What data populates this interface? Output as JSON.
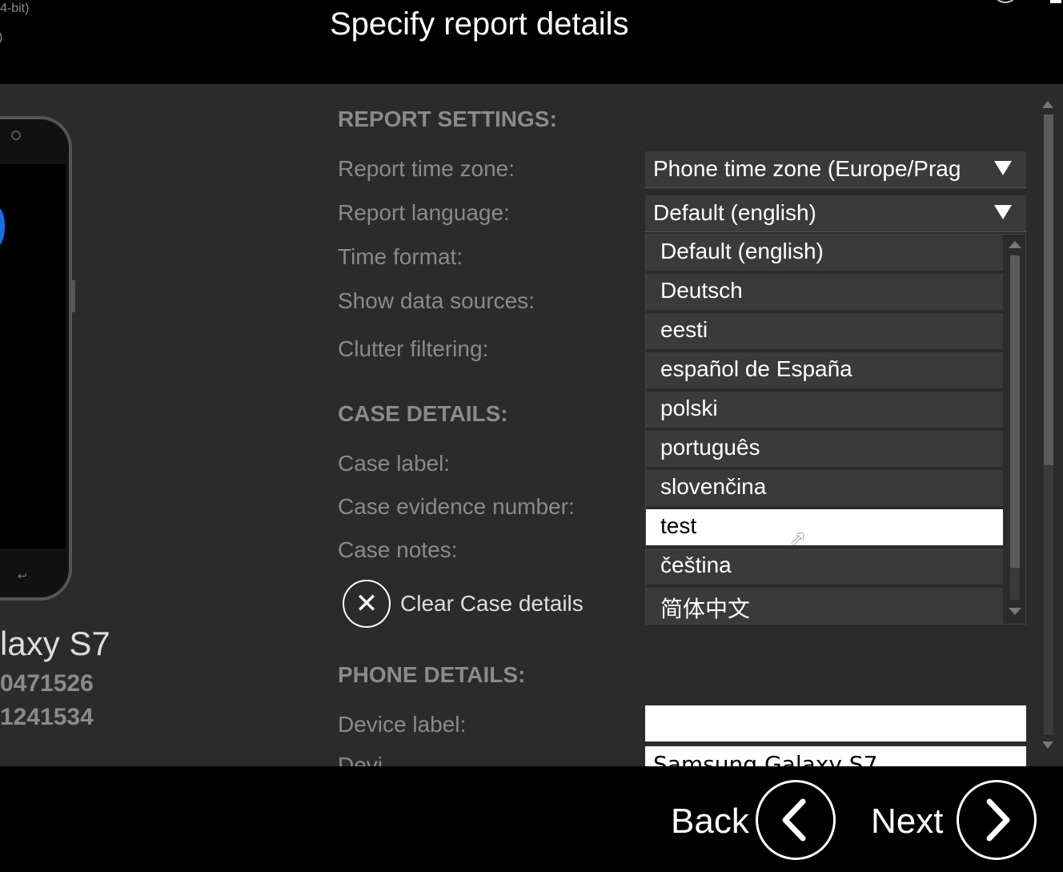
{
  "header": {
    "title": "Specify report details",
    "corner_text_1": "4-bit)",
    "corner_text_2": ")"
  },
  "device": {
    "model": "laxy S7",
    "line1": "0471526",
    "line2": "1241534"
  },
  "report_settings": {
    "heading": "REPORT SETTINGS:",
    "time_zone_label": "Report time zone:",
    "time_zone_value": "Phone time zone (Europe/Prag",
    "language_label": "Report language:",
    "language_value": "Default (english)",
    "time_format_label": "Time format:",
    "show_sources_label": "Show data sources:",
    "clutter_label": "Clutter filtering:"
  },
  "language_options": [
    "Default (english)",
    "Deutsch",
    "eesti",
    "español de España",
    "polski",
    "português",
    "slovenčina",
    "test",
    "čeština",
    "简体中文"
  ],
  "language_highlighted": "test",
  "case_details": {
    "heading": "CASE DETAILS:",
    "case_label": "Case label:",
    "evidence_label": "Case evidence number:",
    "notes_label": "Case notes:",
    "clear_label": "Clear Case details"
  },
  "phone_details": {
    "heading": "PHONE DETAILS:",
    "device_label": "Device label:",
    "device_label_value": "",
    "next_label_partial": "Devi",
    "next_value_partial": "Samsung Galaxy S7"
  },
  "footer": {
    "back_label": "Back",
    "next_label": "Next"
  }
}
